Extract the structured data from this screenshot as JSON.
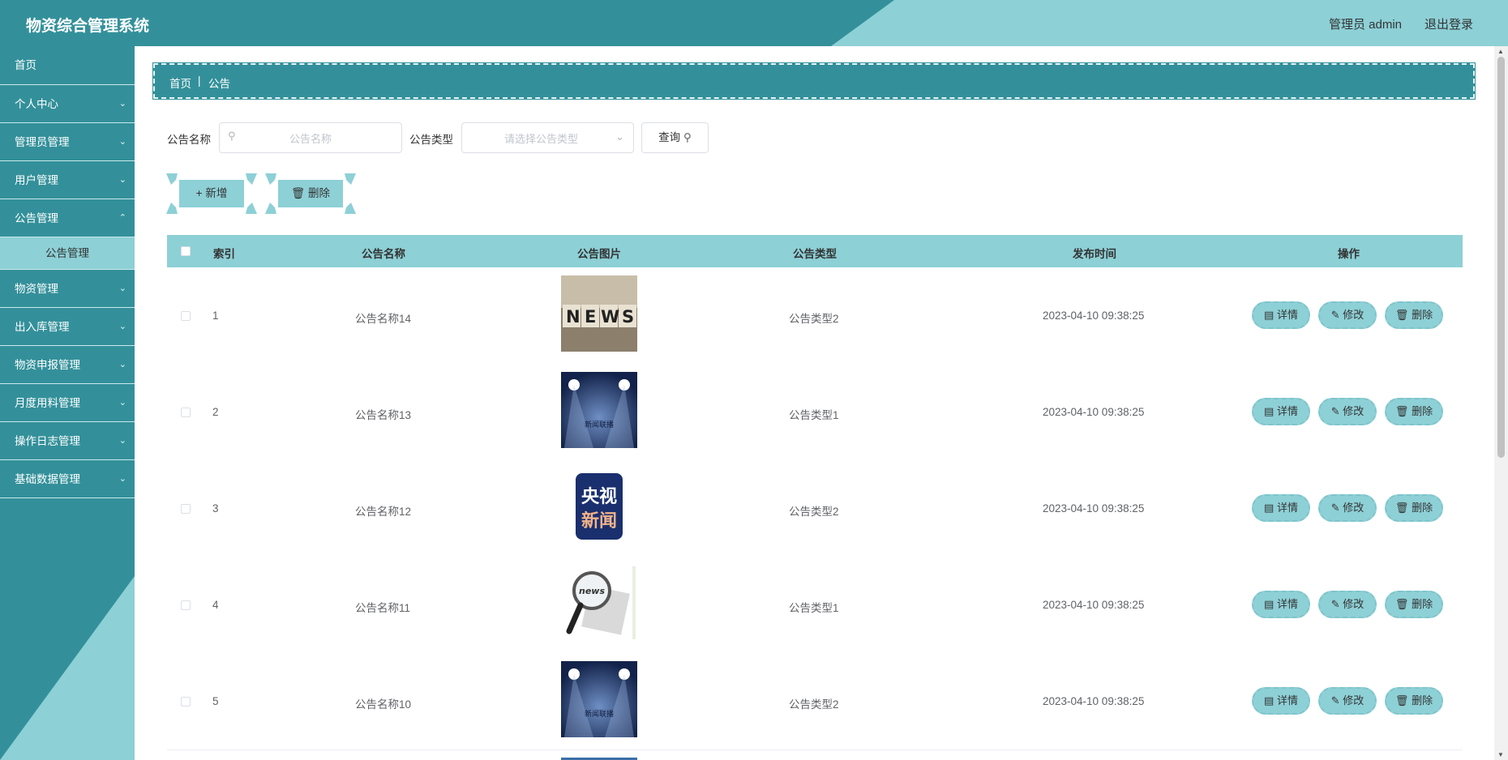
{
  "header": {
    "title": "物资综合管理系统",
    "user": "管理员 admin",
    "logout": "退出登录"
  },
  "sidebar": {
    "items": [
      {
        "label": "首页",
        "expandable": false
      },
      {
        "label": "个人中心",
        "expandable": true
      },
      {
        "label": "管理员管理",
        "expandable": true
      },
      {
        "label": "用户管理",
        "expandable": true
      },
      {
        "label": "公告管理",
        "expandable": true,
        "open": true
      },
      {
        "label": "物资管理",
        "expandable": true
      },
      {
        "label": "出入库管理",
        "expandable": true
      },
      {
        "label": "物资申报管理",
        "expandable": true
      },
      {
        "label": "月度用料管理",
        "expandable": true
      },
      {
        "label": "操作日志管理",
        "expandable": true
      },
      {
        "label": "基础数据管理",
        "expandable": true
      }
    ],
    "submenu_active": "公告管理"
  },
  "breadcrumb": {
    "home": "首页",
    "separator": "|",
    "current": "公告"
  },
  "search": {
    "name_label": "公告名称",
    "name_placeholder": "公告名称",
    "type_label": "公告类型",
    "type_placeholder": "请选择公告类型",
    "query_button": "查询"
  },
  "actions": {
    "add": "新增",
    "delete": "删除"
  },
  "table": {
    "headers": {
      "index": "索引",
      "name": "公告名称",
      "image": "公告图片",
      "type": "公告类型",
      "time": "发布时间",
      "ops": "操作"
    },
    "rows": [
      {
        "index": "1",
        "name": "公告名称14",
        "image": "news-blocks",
        "type": "公告类型2",
        "time": "2023-04-10 09:38:25"
      },
      {
        "index": "2",
        "name": "公告名称13",
        "image": "stage-news",
        "type": "公告类型1",
        "time": "2023-04-10 09:38:25"
      },
      {
        "index": "3",
        "name": "公告名称12",
        "image": "cctv-news",
        "type": "公告类型2",
        "time": "2023-04-10 09:38:25"
      },
      {
        "index": "4",
        "name": "公告名称11",
        "image": "magnifier-news",
        "type": "公告类型1",
        "time": "2023-04-10 09:38:25"
      },
      {
        "index": "5",
        "name": "公告名称10",
        "image": "stage-news",
        "type": "公告类型2",
        "time": "2023-04-10 09:38:25"
      }
    ],
    "op_labels": {
      "detail": "详情",
      "edit": "修改",
      "delete": "删除"
    },
    "image_texts": {
      "news": "NEWS",
      "stage": "新闻联播",
      "cctv1": "央视",
      "cctv2": "新闻",
      "mag": "news"
    }
  },
  "colors": {
    "primary": "#33909a",
    "light": "#8dd0d6"
  }
}
